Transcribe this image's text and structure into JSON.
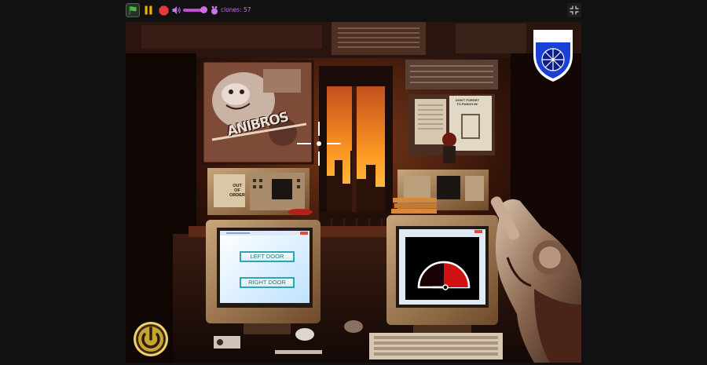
{
  "toolbar": {
    "clones_text": "clones: 57",
    "volume_level": 0.75
  },
  "stage": {
    "power_label": "POWER",
    "left_door_label": "LEFT DOOR",
    "right_door_label": "RIGHT DOOR",
    "sign_out_of_order": "OUT\nOF\nORDER",
    "poster_text": "DON'T FORGET\nTO PUNCH IN!",
    "graffiti_text": "ANIBROS"
  },
  "icons": [
    "green-flag-icon",
    "pause-icon",
    "stop-icon",
    "volume-icon",
    "clone-icon",
    "fullscreen-exit-icon",
    "power-shield-icon",
    "crosshair-icon",
    "gauge-icon",
    "power-button-icon",
    "revolver"
  ],
  "colors": {
    "accent_purple": "#c04fd0",
    "flag_green": "#3bbf3b",
    "pause_yellow": "#f0b000",
    "stop_red": "#e33b3b",
    "door_button_border": "#2aa6b8",
    "shield_blue": "#1a3fd6"
  }
}
